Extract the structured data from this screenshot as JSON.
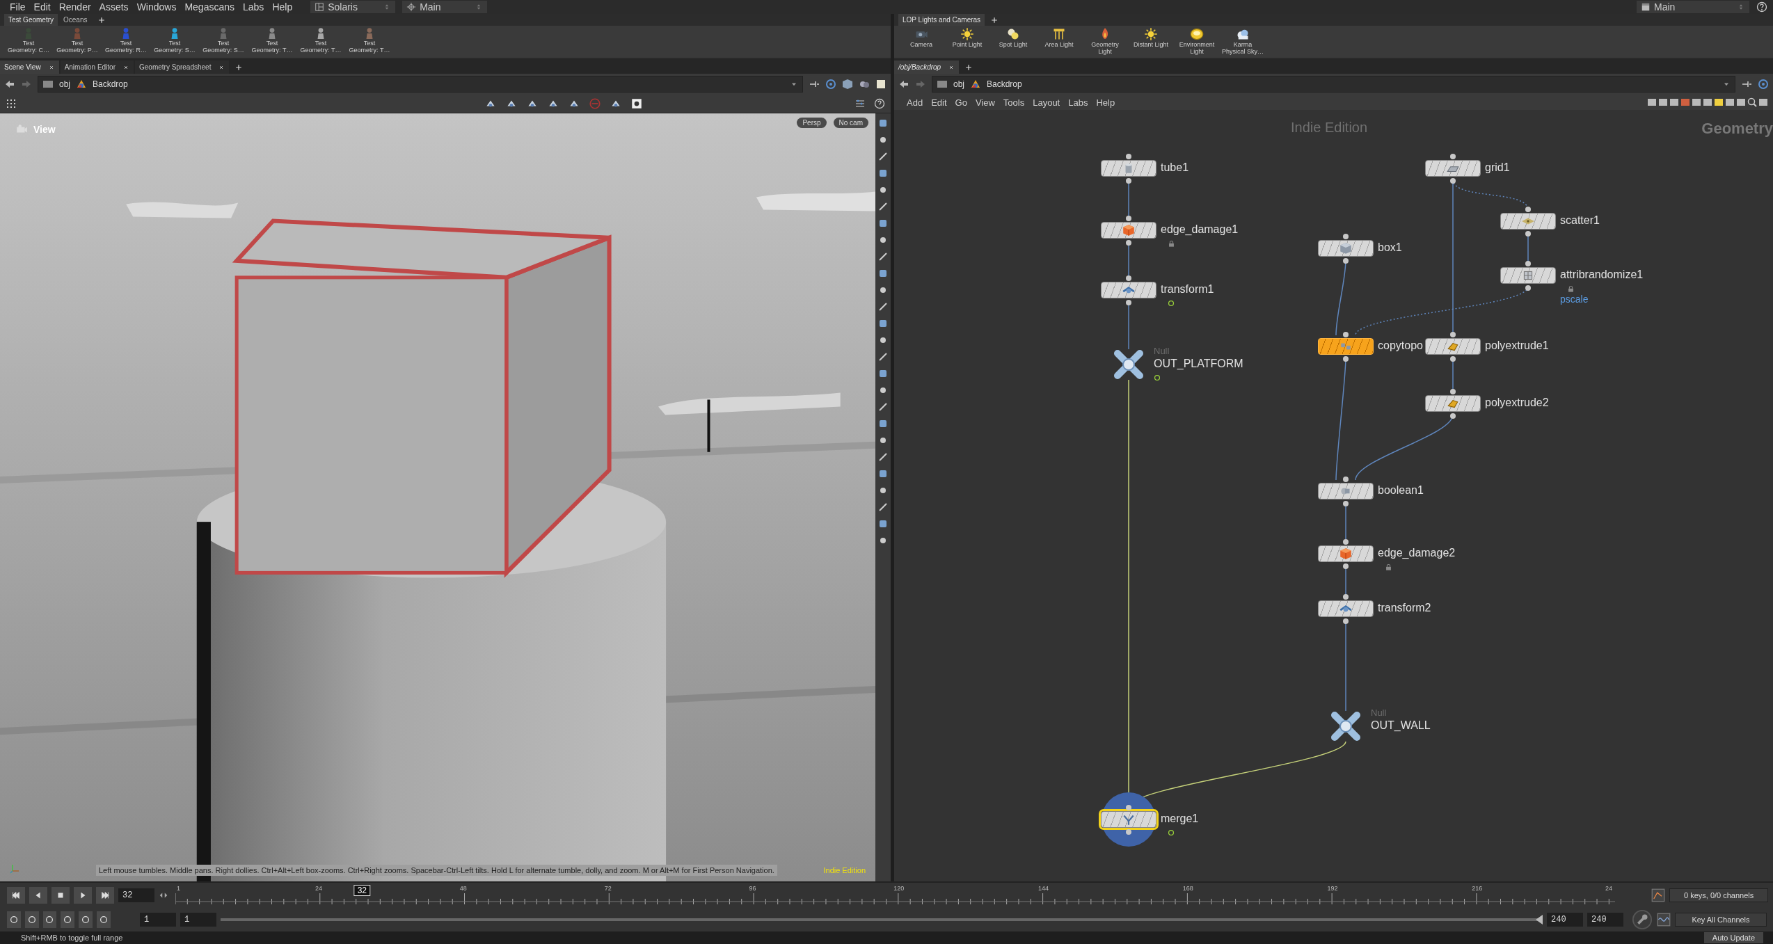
{
  "menubar": {
    "menus": [
      "File",
      "Edit",
      "Render",
      "Assets",
      "Windows",
      "Megascans",
      "Labs",
      "Help"
    ],
    "desktop": "Solaris",
    "context": "Main",
    "right_context": "Main"
  },
  "left_shelf": {
    "tabs": [
      {
        "label": "Test Geometry",
        "selected": true
      },
      {
        "label": "Oceans",
        "selected": false
      }
    ],
    "tools": [
      {
        "lines": [
          "Test",
          "Geometry: C…"
        ]
      },
      {
        "lines": [
          "Test",
          "Geometry: P…"
        ]
      },
      {
        "lines": [
          "Test",
          "Geometry: R…"
        ]
      },
      {
        "lines": [
          "Test",
          "Geometry: S…"
        ]
      },
      {
        "lines": [
          "Test",
          "Geometry: S…"
        ]
      },
      {
        "lines": [
          "Test",
          "Geometry: T…"
        ]
      },
      {
        "lines": [
          "Test",
          "Geometry: T…"
        ]
      },
      {
        "lines": [
          "Test",
          "Geometry: T…"
        ]
      }
    ]
  },
  "left_pane": {
    "tabs": [
      {
        "label": "Scene View",
        "selected": true
      },
      {
        "label": "Animation Editor",
        "selected": false
      },
      {
        "label": "Geometry Spreadsheet",
        "selected": false
      }
    ],
    "path": [
      "obj",
      "Backdrop"
    ]
  },
  "viewport": {
    "title": "View",
    "camera_buttons": [
      "Persp",
      "No cam"
    ],
    "hint": "Left mouse tumbles. Middle pans. Right dollies. Ctrl+Alt+Left box-zooms. Ctrl+Right zooms. Spacebar-Ctrl-Left tilts. Hold L for alternate tumble, dolly, and zoom. M or Alt+M for First Person Navigation.",
    "edition": "Indie Edition",
    "scene": {
      "kind": "picture"
    }
  },
  "right_shelf": {
    "tabs": [
      {
        "label": "LOP Lights and Cameras",
        "selected": true
      }
    ],
    "tools": [
      {
        "lines": [
          "Camera"
        ]
      },
      {
        "lines": [
          "Point Light"
        ]
      },
      {
        "lines": [
          "Spot Light"
        ]
      },
      {
        "lines": [
          "Area Light"
        ]
      },
      {
        "lines": [
          "Geometry",
          "Light"
        ]
      },
      {
        "lines": [
          "Distant Light"
        ]
      },
      {
        "lines": [
          "Environment",
          "Light"
        ]
      },
      {
        "lines": [
          "Karma",
          "Physical Sky…"
        ]
      }
    ]
  },
  "network": {
    "tab": "/obj/Backdrop",
    "path": [
      "obj",
      "Backdrop"
    ],
    "menus": [
      "Add",
      "Edit",
      "Go",
      "View",
      "Tools",
      "Layout",
      "Labs",
      "Help"
    ],
    "edition": "Indie Edition",
    "context": "Geometry",
    "nodes": [
      {
        "name": "tube1",
        "kind": "tube",
        "selected": false,
        "display": false,
        "locked": false,
        "flagged": false
      },
      {
        "name": "edge_damage1",
        "kind": "edge_damage",
        "selected": false,
        "display": false,
        "locked": true,
        "flagged": false
      },
      {
        "name": "transform1",
        "kind": "transform",
        "selected": false,
        "display": false,
        "locked": false,
        "flagged": true
      },
      {
        "name": "OUT_PLATFORM",
        "kind": "null",
        "type_label": "Null",
        "selected": false,
        "display": false,
        "locked": false,
        "flagged": true
      },
      {
        "name": "box1",
        "kind": "box",
        "selected": false,
        "display": false,
        "locked": false,
        "flagged": false
      },
      {
        "name": "grid1",
        "kind": "grid",
        "selected": false,
        "display": false,
        "locked": false,
        "flagged": false
      },
      {
        "name": "scatter1",
        "kind": "scatter",
        "selected": false,
        "display": false,
        "locked": false,
        "flagged": false
      },
      {
        "name": "attribrandomize1",
        "kind": "attribrandomize",
        "note": "pscale",
        "selected": false,
        "display": false,
        "locked": true,
        "flagged": false
      },
      {
        "name": "copytopo",
        "kind": "copytopoints",
        "selected": true,
        "display": false,
        "locked": false,
        "flagged": false
      },
      {
        "name": "polyextrude1",
        "kind": "polyextrude",
        "selected": false,
        "display": false,
        "locked": false,
        "flagged": false
      },
      {
        "name": "polyextrude2",
        "kind": "polyextrude",
        "selected": false,
        "display": false,
        "locked": false,
        "flagged": false
      },
      {
        "name": "boolean1",
        "kind": "boolean",
        "selected": false,
        "display": false,
        "locked": false,
        "flagged": false
      },
      {
        "name": "edge_damage2",
        "kind": "edge_damage",
        "selected": false,
        "display": false,
        "locked": true,
        "flagged": false
      },
      {
        "name": "transform2",
        "kind": "transform",
        "selected": false,
        "display": false,
        "locked": false,
        "flagged": false
      },
      {
        "name": "OUT_WALL",
        "kind": "null",
        "type_label": "Null",
        "selected": false,
        "display": false,
        "locked": false,
        "flagged": false
      },
      {
        "name": "merge1",
        "kind": "merge",
        "selected": false,
        "display": true,
        "locked": false,
        "flagged": true
      }
    ]
  },
  "timeline": {
    "frame": "32",
    "ticks": [
      "1",
      "24",
      "48",
      "72",
      "96",
      "120",
      "144",
      "168",
      "192",
      "216",
      "24"
    ],
    "playhead": {
      "label": "32",
      "level": 0.1297
    },
    "range_start": [
      "1",
      "1"
    ],
    "range_end": [
      "240",
      "240"
    ],
    "range_bar": {
      "level": 1
    },
    "keys": "0 keys, 0/0 channels",
    "key_mode": "Key All Channels"
  },
  "status_bar": {
    "message": "Shift+RMB to toggle full range",
    "update_mode": "Auto Update"
  }
}
